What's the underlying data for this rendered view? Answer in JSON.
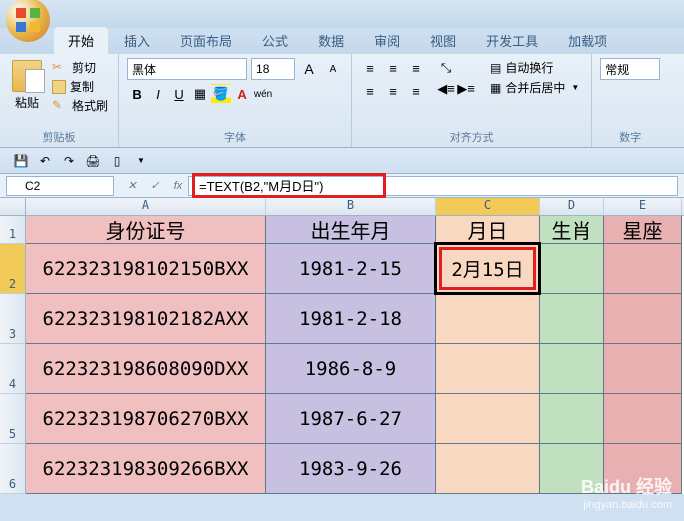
{
  "tabs": [
    "开始",
    "插入",
    "页面布局",
    "公式",
    "数据",
    "审阅",
    "视图",
    "开发工具",
    "加载项"
  ],
  "active_tab_index": 0,
  "clipboard": {
    "paste": "粘贴",
    "cut": "剪切",
    "copy": "复制",
    "format_painter": "格式刷",
    "group_label": "剪贴板"
  },
  "font": {
    "family": "黑体",
    "size": "18",
    "group_label": "字体"
  },
  "alignment": {
    "wrap": "自动换行",
    "merge": "合并后居中",
    "group_label": "对齐方式"
  },
  "number": {
    "format": "常规",
    "group_label": "数字"
  },
  "name_box": "C2",
  "formula": "=TEXT(B2,\"M月D日\")",
  "columns": [
    "A",
    "B",
    "C",
    "D",
    "E"
  ],
  "headers": {
    "A": "身份证号",
    "B": "出生年月",
    "C": "月日",
    "D": "生肖",
    "E": "星座"
  },
  "rows": [
    {
      "n": "2",
      "A": "622323198102150BXX",
      "B": "1981-2-15",
      "C": "2月15日"
    },
    {
      "n": "3",
      "A": "622323198102182AXX",
      "B": "1981-2-18",
      "C": ""
    },
    {
      "n": "4",
      "A": "622323198608090DXX",
      "B": "1986-8-9",
      "C": ""
    },
    {
      "n": "5",
      "A": "622323198706270BXX",
      "B": "1987-6-27",
      "C": ""
    },
    {
      "n": "6",
      "A": "622323198309266BXX",
      "B": "1983-9-26",
      "C": ""
    }
  ],
  "watermark": {
    "brand": "Baidu 经验",
    "url": "jingyan.baidu.com"
  }
}
